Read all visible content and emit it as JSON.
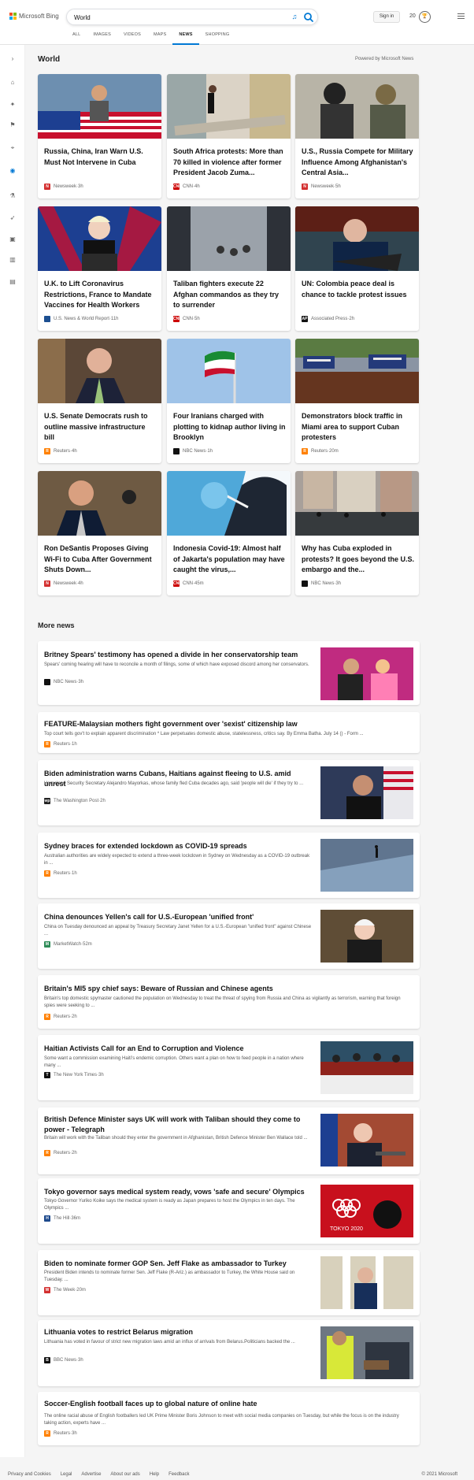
{
  "header": {
    "brand": "Microsoft Bing",
    "search_value": "World",
    "signin_label": "Sign in",
    "reward_count": "20",
    "tabs": [
      {
        "label": "ALL"
      },
      {
        "label": "IMAGES"
      },
      {
        "label": "VIDEOS"
      },
      {
        "label": "MAPS"
      },
      {
        "label": "NEWS",
        "active": true
      },
      {
        "label": "SHOPPING"
      }
    ]
  },
  "rail": {
    "icons": [
      "expand-icon",
      "home-icon",
      "ai-icon",
      "flag-icon",
      "location-icon",
      "globe-icon",
      "science-icon",
      "rocket-icon",
      "tv-icon",
      "business-icon",
      "money-icon"
    ]
  },
  "section": {
    "title": "World",
    "powered_by": "Powered by Microsoft News"
  },
  "cards": [
    {
      "title": "Russia, China, Iran Warn U.S. Must Not Intervene in Cuba",
      "source": "Newsweek",
      "time": "3h",
      "icon": "newsweek-icon",
      "icon_text": "N",
      "icon_color": "#d32f2f",
      "theme": "rally"
    },
    {
      "title": "South Africa protests: More than 70 killed in violence after former President Jacob Zuma...",
      "source": "CNN",
      "time": "4h",
      "icon": "cnn-icon",
      "icon_text": "CNN",
      "icon_color": "#cc0000",
      "theme": "store"
    },
    {
      "title": "U.S., Russia Compete for Military Influence Among Afghanistan's Central Asia...",
      "source": "Newsweek",
      "time": "5h",
      "icon": "newsweek-icon",
      "icon_text": "N",
      "icon_color": "#d32f2f",
      "theme": "soldiers"
    },
    {
      "title": "U.K. to Lift Coronavirus Restrictions, France to Mandate Vaccines for Health Workers",
      "source": "U.S. News & World Report",
      "time": "11h",
      "icon": "usnews-icon",
      "icon_text": "",
      "icon_color": "#1d4f91",
      "theme": "podium"
    },
    {
      "title": "Taliban fighters execute 22 Afghan commandos as they try to surrender",
      "source": "CNN",
      "time": "5h",
      "icon": "cnn-icon",
      "icon_text": "CNN",
      "icon_color": "#cc0000",
      "theme": "smoke"
    },
    {
      "title": "UN: Colombia peace deal is chance to tackle protest issues",
      "source": "Associated Press",
      "time": "2h",
      "icon": "ap-icon",
      "icon_text": "AP",
      "icon_color": "#111111",
      "theme": "leader"
    },
    {
      "title": "U.S. Senate Democrats rush to outline massive infrastructure bill",
      "source": "Reuters",
      "time": "4h",
      "icon": "reuters-icon",
      "icon_text": "R",
      "icon_color": "#ff8000",
      "theme": "senator"
    },
    {
      "title": "Four Iranians charged with plotting to kidnap author living in Brooklyn",
      "source": "NBC News",
      "time": "1h",
      "icon": "nbc-icon",
      "icon_text": "",
      "icon_color": "#111111",
      "theme": "flag"
    },
    {
      "title": "Demonstrators block traffic in Miami area to support Cuban protesters",
      "source": "Reuters",
      "time": "20m",
      "icon": "reuters-icon",
      "icon_text": "R",
      "icon_color": "#ff8000",
      "theme": "crowd"
    },
    {
      "title": "Ron DeSantis Proposes Giving Wi-Fi to Cuba After Government Shuts Down...",
      "source": "Newsweek",
      "time": "4h",
      "icon": "newsweek-icon",
      "icon_text": "N",
      "icon_color": "#d32f2f",
      "theme": "desantis"
    },
    {
      "title": "Indonesia Covid-19: Almost half of Jakarta's population may have caught the virus,...",
      "source": "CNN",
      "time": "45m",
      "icon": "cnn-icon",
      "icon_text": "CNN",
      "icon_color": "#cc0000",
      "theme": "swab"
    },
    {
      "title": "Why has Cuba exploded in protests? It goes beyond the U.S. embargo and the...",
      "source": "NBC News",
      "time": "3h",
      "icon": "nbc-icon",
      "icon_text": "",
      "icon_color": "#111111",
      "theme": "street"
    }
  ],
  "more": {
    "title": "More news",
    "items": [
      {
        "title": "Britney Spears' testimony has opened a divide in her conservatorship team",
        "snippet": "Spears' coming hearing will have to reconcile a month of filings, some of which have exposed discord among her conservators.",
        "source": "NBC News",
        "time": "3h",
        "icon": "nbc-icon",
        "icon_text": "",
        "icon_color": "#111111",
        "theme": "britney"
      },
      {
        "title": "FEATURE-Malaysian mothers fight government over 'sexist' citizenship law",
        "snippet": "Top court tells gov't to explain apparent discrimination * Law perpetuates domestic abuse, statelessness, critics say. By Emma Batha. July 14 () - Form ...",
        "source": "Reuters",
        "time": "1h",
        "icon": "reuters-icon",
        "icon_text": "R",
        "icon_color": "#ff8000",
        "theme": ""
      },
      {
        "title": "Biden administration warns Cubans, Haitians against fleeing to U.S. amid unrest",
        "snippet": "Homeland Security Secretary Alejandro Mayorkas, whose family fled Cuba decades ago, said 'people will die' if they try to ...",
        "source": "The Washington Post",
        "time": "2h",
        "icon": "wapo-icon",
        "icon_text": "wp",
        "icon_color": "#222222",
        "theme": "mayorkas"
      },
      {
        "title": "Sydney braces for extended lockdown as COVID-19 spreads",
        "snippet": "Australian authorities are widely expected to extend a three-week lockdown in Sydney on Wednesday as a COVID-19 outbreak in ...",
        "source": "Reuters",
        "time": "1h",
        "icon": "reuters-icon",
        "icon_text": "R",
        "icon_color": "#ff8000",
        "theme": "sydney"
      },
      {
        "title": "China denounces Yellen's call for U.S.-European 'unified front'",
        "snippet": "China on Tuesday denounced an appeal by Treasury Secretary Janet Yellen for a U.S.-European \"unified front\" against Chinese ...",
        "source": "MarketWatch",
        "time": "52m",
        "icon": "marketwatch-icon",
        "icon_text": "M",
        "icon_color": "#2e8b57",
        "theme": "yellen"
      },
      {
        "title": "Britain's MI5 spy chief says: Beware of Russian and Chinese agents",
        "snippet": "Britain's top domestic spymaster cautioned the population on Wednesday to treat the threat of spying from Russia and China as vigilantly as terrorism, warning that foreign spies were seeking to ...",
        "source": "Reuters",
        "time": "2h",
        "icon": "reuters-icon",
        "icon_text": "R",
        "icon_color": "#ff8000",
        "theme": ""
      },
      {
        "title": "Haitian Activists Call for an End to Corruption and Violence",
        "snippet": "Some want a commission examining Haiti's endemic corruption. Others want a plan on how to feed people in a nation where many ...",
        "source": "The New York Times",
        "time": "3h",
        "icon": "nyt-icon",
        "icon_text": "T",
        "icon_color": "#111111",
        "theme": "haiti"
      },
      {
        "title": "British Defence Minister says UK will work with Taliban should they come to power - Telegraph",
        "snippet": "Britain will work with the Taliban should they enter the government in Afghanistan, British Defence Minister Ben Wallace told ...",
        "source": "Reuters",
        "time": "2h",
        "icon": "reuters-icon",
        "icon_text": "R",
        "icon_color": "#ff8000",
        "theme": "wallace"
      },
      {
        "title": "Tokyo governor says medical system ready, vows 'safe and secure' Olympics",
        "snippet": "Tokyo Governor Yuriko Koike says the medical system is ready as Japan prepares to host the Olympics in ten days. The Olympics ...",
        "source": "The Hill",
        "time": "36m",
        "icon": "hill-icon",
        "icon_text": "H",
        "icon_color": "#1e4a8c",
        "theme": "tokyo"
      },
      {
        "title": "Biden to nominate former GOP Sen. Jeff Flake as ambassador to Turkey",
        "snippet": "President Biden intends to nominate former Sen. Jeff Flake (R-Ariz.) as ambassador to Turkey, the White House said on Tuesday. ...",
        "source": "The Week",
        "time": "20m",
        "icon": "theweek-icon",
        "icon_text": "W",
        "icon_color": "#d32f2f",
        "theme": "flake"
      },
      {
        "title": "Lithuania votes to restrict Belarus migration",
        "snippet": "Lithuania has voted in favour of strict new migration laws amid an influx of arrivals from Belarus.Politicians backed the ...",
        "source": "BBC News",
        "time": "3h",
        "icon": "bbc-icon",
        "icon_text": "B",
        "icon_color": "#111111",
        "theme": "lithuania"
      },
      {
        "title": "Soccer-English football faces up to global nature of online hate",
        "snippet": "The online racial abuse of English footballers led UK Prime Minister Boris Johnson to meet with social media companies on Tuesday, but while the focus is on the industry taking action, experts have ...",
        "source": "Reuters",
        "time": "3h",
        "icon": "reuters-icon",
        "icon_text": "R",
        "icon_color": "#ff8000",
        "theme": ""
      }
    ]
  },
  "footer": {
    "links": [
      "Privacy and Cookies",
      "Legal",
      "Advertise",
      "About our ads",
      "Help",
      "Feedback"
    ],
    "copyright": "© 2021 Microsoft"
  }
}
